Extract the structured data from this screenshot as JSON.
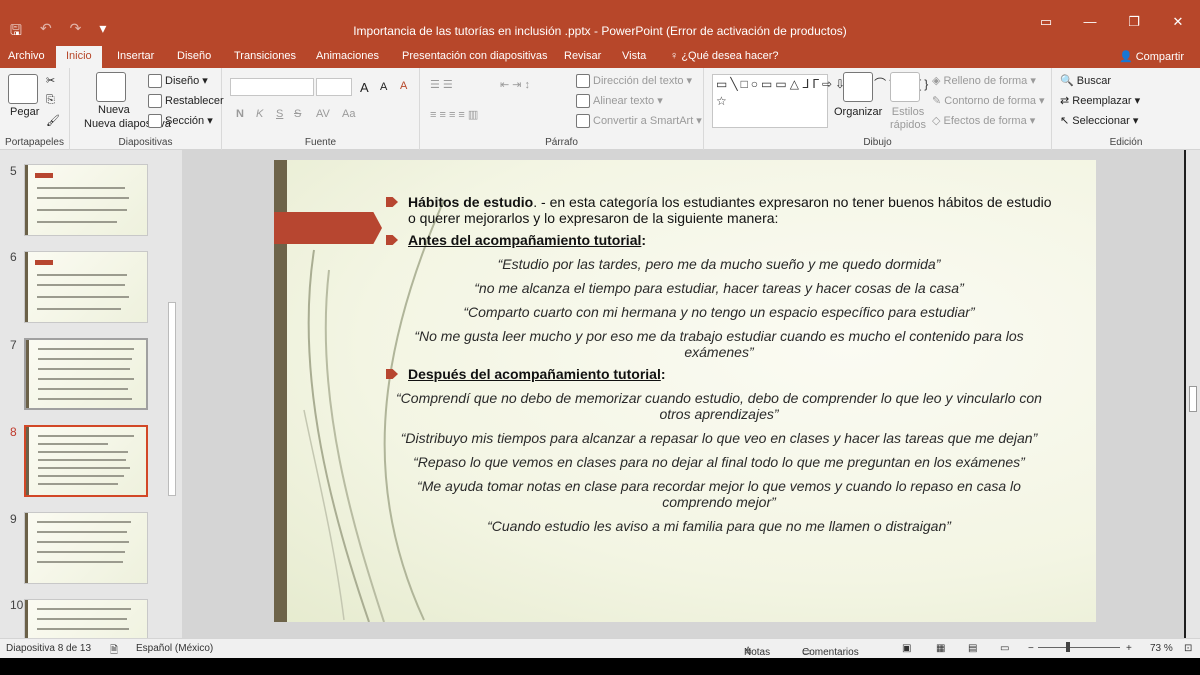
{
  "window": {
    "title": "Importancia de las tutorías en inclusión .pptx - PowerPoint (Error de activación de productos)",
    "accent": "#b7472a"
  },
  "qat": {
    "save": "🖫",
    "undo": "↶",
    "redo": "↷",
    "customize": "▾"
  },
  "tabs": [
    "Archivo",
    "Inicio",
    "Insertar",
    "Diseño",
    "Transiciones",
    "Animaciones",
    "Presentación con diapositivas",
    "Revisar",
    "Vista",
    "¿Qué desea hacer?"
  ],
  "share": "Compartir",
  "ribbon": {
    "portapapeles": {
      "label": "Portapapeles",
      "paste": "Pegar"
    },
    "diapositivas": {
      "label": "Diapositivas",
      "new_slide": "Nueva diapositiva",
      "layout": "Diseño",
      "reset": "Restablecer",
      "section": "Sección"
    },
    "fuente": {
      "label": "Fuente",
      "bold": "N",
      "italic": "K",
      "underline": "S",
      "strike": "S",
      "spacing": "AV",
      "case": "Aa",
      "grow": "A",
      "shrink": "A",
      "clear": "A"
    },
    "parrafo": {
      "label": "Párrafo",
      "direction": "Dirección del texto",
      "align": "Alinear texto",
      "smartart": "Convertir a SmartArt"
    },
    "dibujo": {
      "label": "Dibujo",
      "arrange": "Organizar",
      "styles": "Estilos rápidos",
      "fill": "Relleno de forma",
      "outline": "Contorno de forma",
      "effects": "Efectos de forma"
    },
    "edicion": {
      "label": "Edición",
      "find": "Buscar",
      "replace": "Reemplazar",
      "select": "Seleccionar"
    }
  },
  "thumbnails": [
    "5",
    "6",
    "7",
    "8",
    "9",
    "10"
  ],
  "slide": {
    "b1_bold": "Hábitos de estudio",
    "b1_rest": ". - en esta categoría los estudiantes expresaron no tener buenos hábitos de estudio o querer mejorarlos y lo expresaron de la siguiente manera:",
    "b2": "Antes del acompañamiento tutorial",
    "q1": "“Estudio por las tardes, pero me da mucho sueño y me quedo dormida”",
    "q2": "“no me alcanza el tiempo para estudiar, hacer tareas y hacer cosas de la casa”",
    "q3": "“Comparto cuarto con mi hermana y no tengo un espacio específico para estudiar”",
    "q4": "“No me gusta leer mucho y por eso me da trabajo estudiar cuando es mucho el contenido para los exámenes”",
    "b3": "Después del acompañamiento tutorial",
    "q5": "“Comprendí que no debo de memorizar cuando estudio, debo de comprender lo que leo y vincularlo con otros aprendizajes”",
    "q6": "“Distribuyo mis tiempos para alcanzar a repasar lo que veo en clases y hacer las tareas que me dejan”",
    "q7": "“Repaso lo que vemos en clases para no dejar al final todo lo que me preguntan en los exámenes”",
    "q8": "“Me ayuda tomar notas en clase para recordar mejor lo que vemos y cuando lo repaso en casa lo comprendo mejor”",
    "q9": "“Cuando estudio les aviso a mi familia para que no me llamen o distraigan”"
  },
  "status": {
    "slide_info": "Diapositiva 8 de 13",
    "language": "Español (México)",
    "notes": "Notas",
    "comments": "Comentarios",
    "zoom": "73 %"
  }
}
